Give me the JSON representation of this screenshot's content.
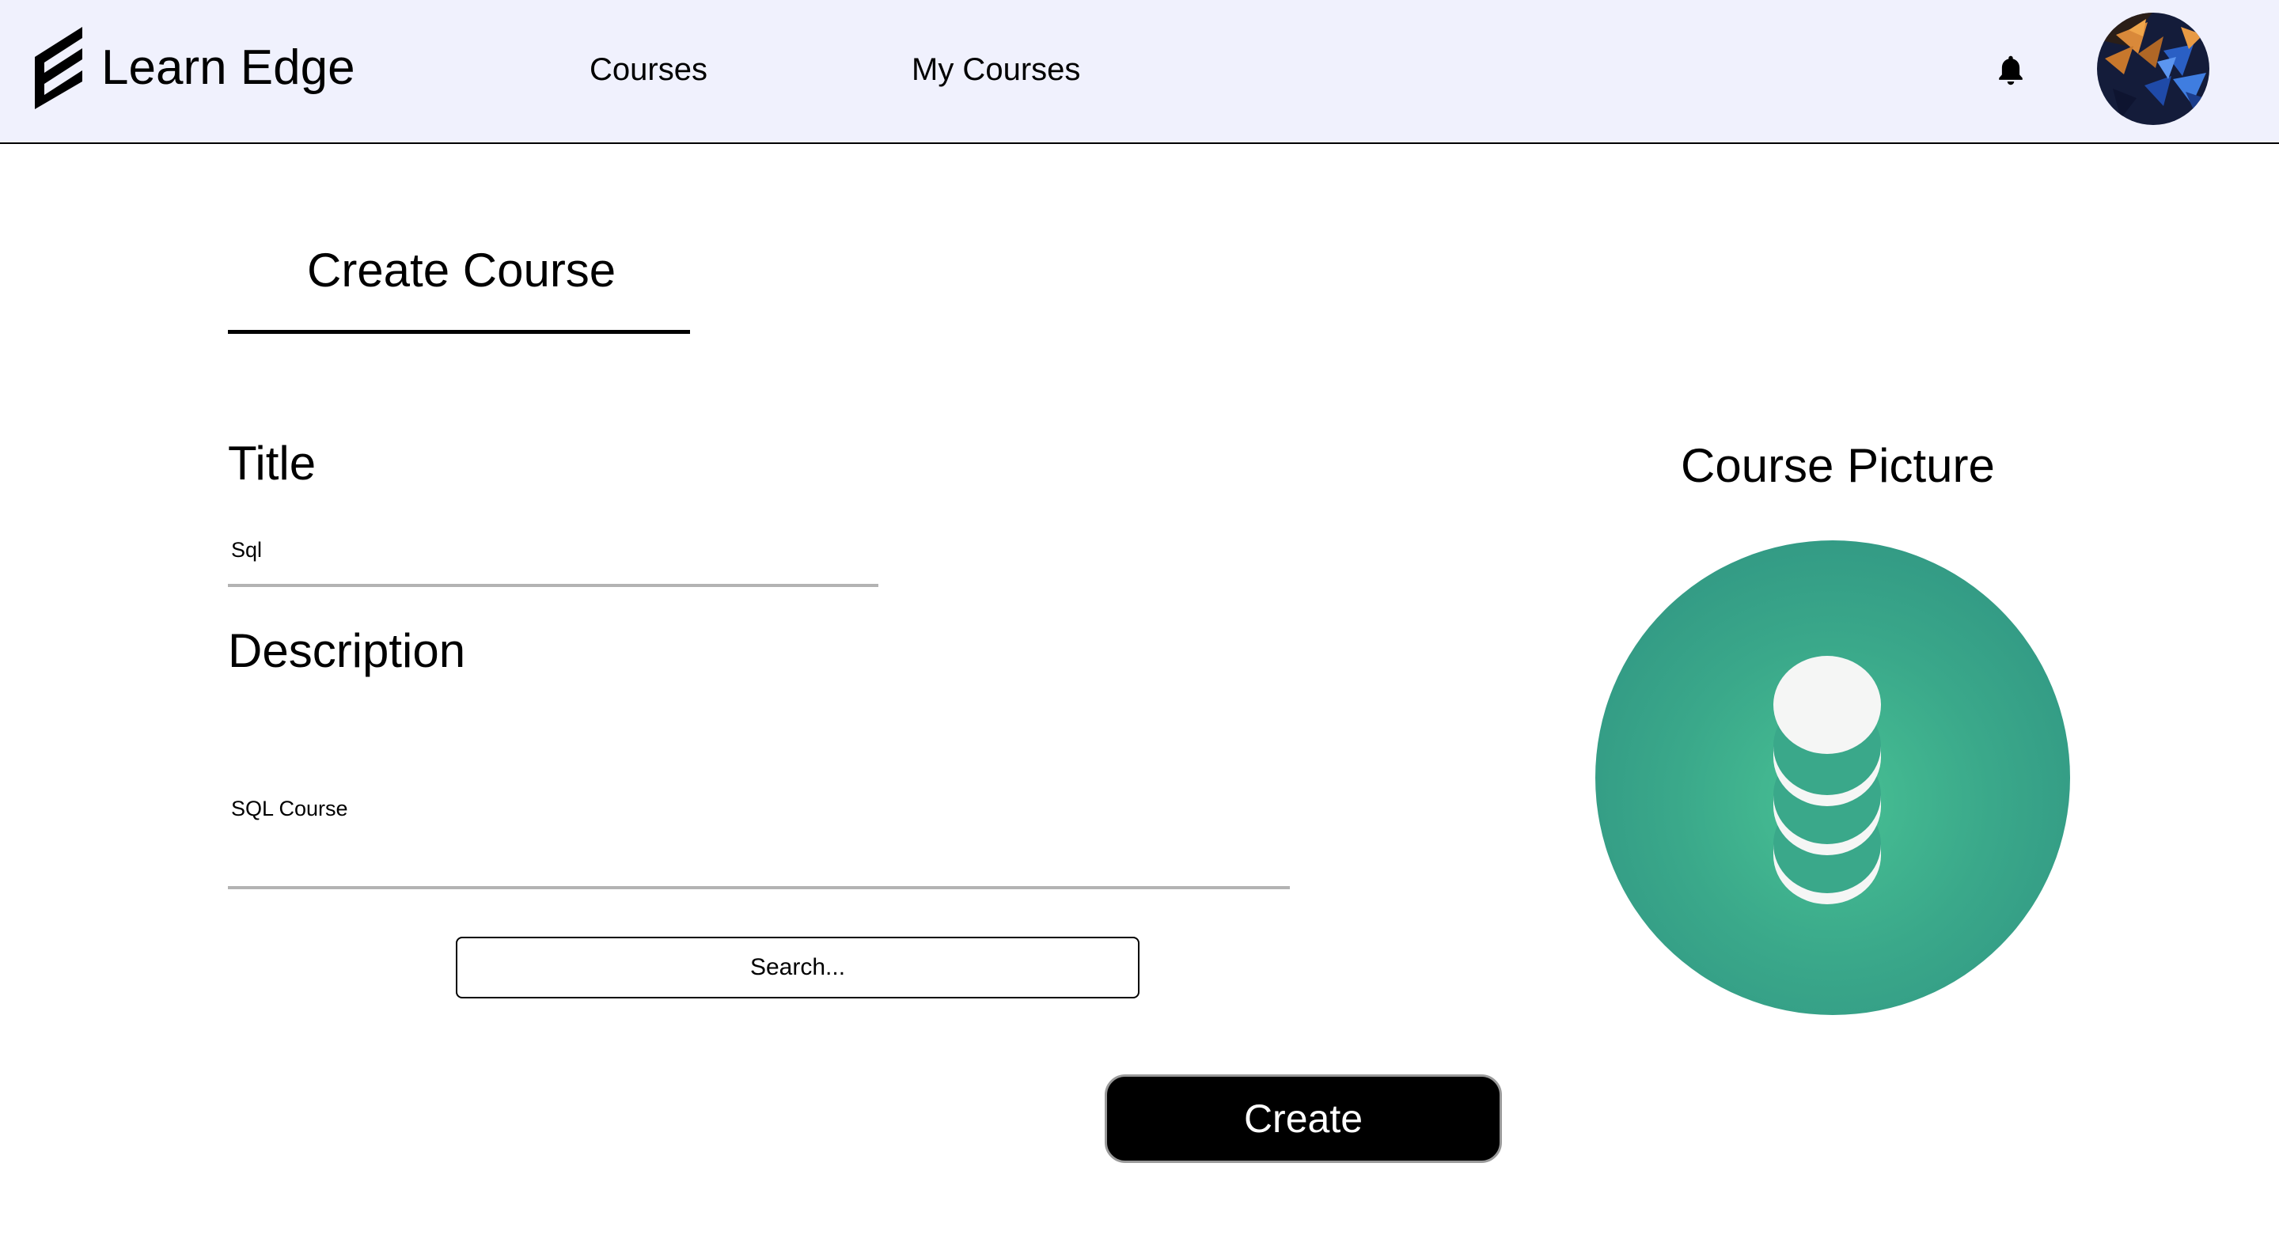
{
  "header": {
    "brand": "Learn Edge",
    "nav": {
      "courses": "Courses",
      "my_courses": "My Courses"
    },
    "icons": {
      "logo": "learn-edge-logo-icon",
      "notifications": "bell-icon",
      "avatar": "user-avatar"
    },
    "background_color": "#f0f1fd"
  },
  "main": {
    "tab_title": "Create Course",
    "form": {
      "title_label": "Title",
      "title_value": "Sql",
      "description_label": "Description",
      "description_value": "SQL Course",
      "search_label": "Search...",
      "create_label": "Create"
    },
    "picture": {
      "label": "Course Picture",
      "icon": "database-icon",
      "color": "#3aa88a"
    }
  }
}
